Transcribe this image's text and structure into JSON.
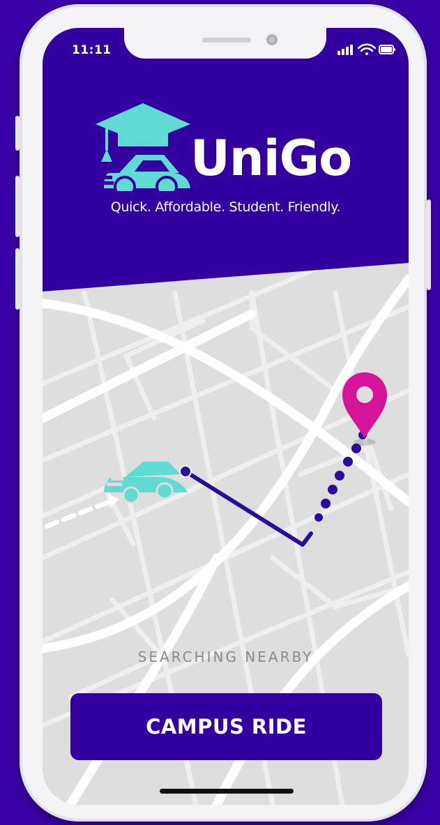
{
  "status_bar": {
    "time": "11:11"
  },
  "header": {
    "brand": "UniGo",
    "tagline": "Quick. Affordable. Student. Friendly."
  },
  "map": {
    "status_text": "SEARCHING NEARBY",
    "icons": {
      "vehicle": "car-icon",
      "destination": "location-pin-icon"
    }
  },
  "actions": {
    "primary_label": "CAMPUS RIDE"
  },
  "colors": {
    "primary": "#33009f",
    "accent": "#5fdbd3",
    "pin": "#d6149a",
    "map_bg": "#dedede"
  }
}
